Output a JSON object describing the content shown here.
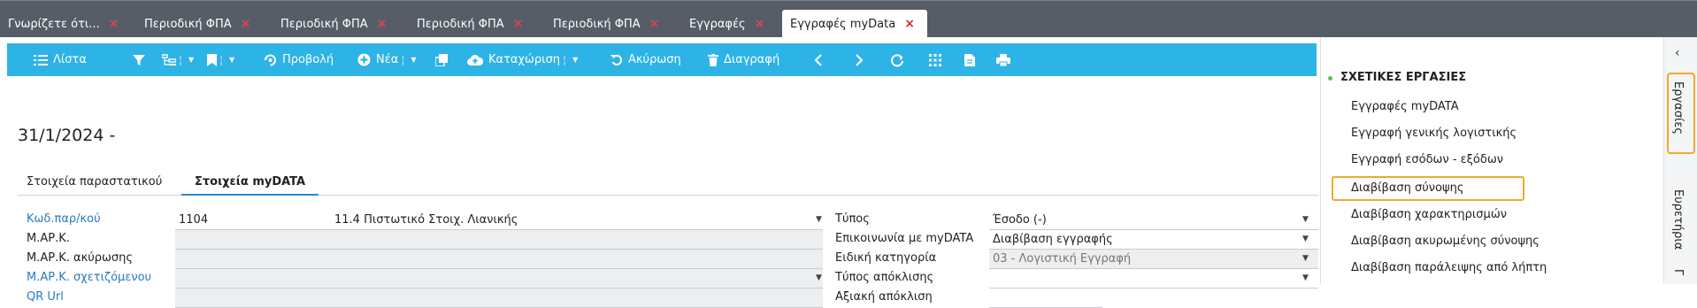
{
  "tabs": [
    {
      "label": "Γνωρίζετε ότι...",
      "active": false
    },
    {
      "label": "Περιοδική ΦΠΑ",
      "active": false
    },
    {
      "label": "Περιοδική ΦΠΑ",
      "active": false
    },
    {
      "label": "Περιοδική ΦΠΑ",
      "active": false
    },
    {
      "label": "Περιοδική ΦΠΑ",
      "active": false
    },
    {
      "label": "Εγγραφές",
      "active": false
    },
    {
      "label": "Εγγραφές myData",
      "active": true
    }
  ],
  "tab_close_glyph": "×",
  "toolbar": {
    "list": "Λίστα",
    "view": "Προβολή",
    "new": "Νέα",
    "submit": "Καταχώριση",
    "cancel": "Ακύρωση",
    "delete": "Διαγραφή"
  },
  "header": {
    "date": "31/1/2024 -"
  },
  "subtabs": {
    "details": "Στοιχεία παραστατικού",
    "mydata": "Στοιχεία myDATA"
  },
  "form_left": {
    "code_label": "Κωδ.παρ/κού",
    "code_value": "1104",
    "code_desc": "11.4 Πιστωτικό Στοιχ. Λιανικής",
    "mark_label": "Μ.ΑΡ.Κ.",
    "mark_cancel_label": "Μ.ΑΡ.Κ. ακύρωσης",
    "mark_related_label": "Μ.ΑΡ.Κ. σχετιζόμενου",
    "qr_label": "QR Url"
  },
  "form_right": {
    "type_label": "Τύπος",
    "type_value": "Έσοδο (-)",
    "comm_label": "Επικοινωνία με myDATA",
    "comm_value": "Διαβίβαση εγγραφής",
    "special_label": "Ειδική κατηγορία",
    "special_value": "03 - Λογιστική Εγγραφή",
    "dev_type_label": "Τύπος απόκλισης",
    "dev_value_label": "Αξιακή απόκλιση"
  },
  "side_panel": {
    "title": "ΣΧΕΤΙΚΕΣ ΕΡΓΑΣΙΕΣ",
    "items": [
      "Εγγραφές myDATA",
      "Εγγραφή γενικής λογιστικής",
      "Εγγραφή εσόδων - εξόδων",
      "Διαβίβαση σύνοψης",
      "Διαβίβαση χαρακτηρισμών",
      "Διαβίβαση ακυρωμένης σύνοψης",
      "Διαβίβαση παράλειψης από λήπτη"
    ]
  },
  "rail": {
    "chevron": "‹",
    "tasks": "Εργασίες",
    "indexes": "Ευρετήρια",
    "partial": "Γ"
  },
  "colors": {
    "accent": "#2db3e5",
    "tabbar": "#565d66",
    "highlight": "#f0a830",
    "link": "#2a7ac0",
    "close": "#e8404f"
  }
}
